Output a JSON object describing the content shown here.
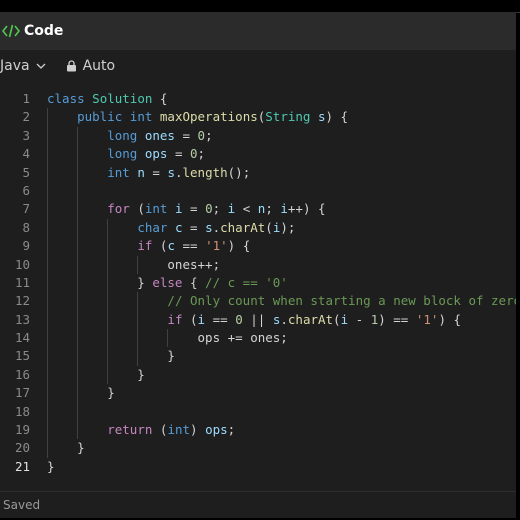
{
  "header": {
    "title": "Code",
    "icon": "code-icon"
  },
  "toolbar": {
    "language": "Java",
    "mode": "Auto",
    "lock_icon": "lock-icon"
  },
  "status": {
    "text": "Saved"
  },
  "editor": {
    "line_numbers": [
      "1",
      "2",
      "3",
      "4",
      "5",
      "6",
      "7",
      "8",
      "9",
      "10",
      "11",
      "12",
      "13",
      "14",
      "15",
      "16",
      "17",
      "18",
      "19",
      "20",
      "21"
    ],
    "active_line": 21,
    "lines": [
      "class Solution {",
      "    public int maxOperations(String s) {",
      "        long ones = 0;",
      "        long ops = 0;",
      "        int n = s.length();",
      "",
      "        for (int i = 0; i < n; i++) {",
      "            char c = s.charAt(i);",
      "            if (c == '1') {",
      "                ones++;",
      "            } else { // c == '0'",
      "                // Only count when starting a new block of zeros",
      "                if (i == 0 || s.charAt(i - 1) == '1') {",
      "                    ops += ones;",
      "                }",
      "            }",
      "        }",
      "",
      "        return (int) ops;",
      "    }",
      "}"
    ]
  },
  "colors": {
    "keyword": "#569cd6",
    "control": "#c586c0",
    "function": "#dcdcaa",
    "class": "#4ec9b0",
    "number": "#b5cea8",
    "string": "#ce9178",
    "variable": "#9cdcfe",
    "comment": "#6a9955",
    "accent": "#4ec94e"
  }
}
